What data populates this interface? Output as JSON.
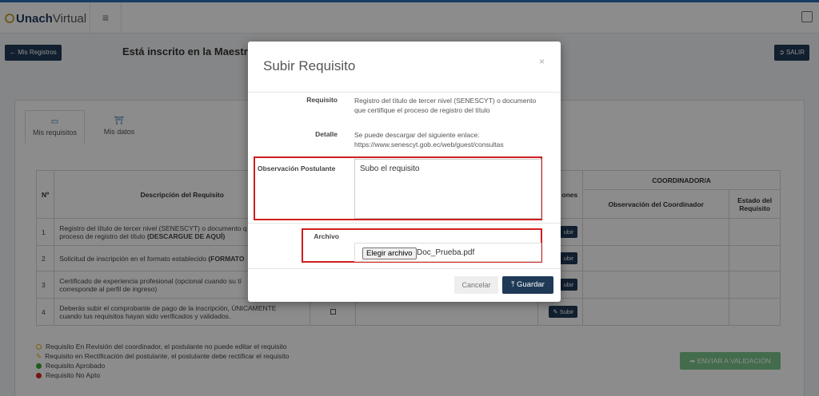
{
  "header": {
    "brand_bold": "Unach",
    "brand_light": "Virtual"
  },
  "toolbar": {
    "mis_registros": "Mis Registros",
    "salir": "SALIR"
  },
  "page": {
    "inscrito_text": "Está inscrito en la Maestría"
  },
  "tabs": [
    {
      "label": "Mis requisitos",
      "icon": "monitor-icon"
    },
    {
      "label": "Mis datos",
      "icon": "institution-icon"
    }
  ],
  "table": {
    "headers": {
      "num": "Nº",
      "descripcion": "Descripción del Requisito",
      "acciones": "ones",
      "coordinador": "COORDINADOR/A",
      "observacion": "Observación del Coordinador",
      "estado": "Estado del Requisito"
    },
    "rows": [
      {
        "num": "1",
        "desc": "Registro del título de tercer nivel (SENESCYT) o documento q",
        "desc2": "proceso de registro del título ",
        "desc2_bold": "(DESCARGUE DE AQUÍ)",
        "action": "ubir"
      },
      {
        "num": "2",
        "desc": "Solicitud de inscripción en el formato establecido ",
        "desc_bold": "(FORMATO",
        "action": "ubir"
      },
      {
        "num": "3",
        "desc": "Certificado de experiencia profesional (opcional cuando su tí",
        "desc2": "corresponde al perfil de ingreso)",
        "action": "ubir"
      },
      {
        "num": "4",
        "desc": "Deberás subir el comprobante de pago de la inscripción, ÚNICAMENTE",
        "desc2": "cuando tus requisitos hayan sido verificados y validados.",
        "action": "Subir"
      }
    ]
  },
  "legend": [
    {
      "text": "Requisito En Revisión del coordinador, el postulante no puede editar el requisito",
      "color": "#e6b400"
    },
    {
      "text": "Requisito en Rectificación del postulante, el postulante debe rectificar el requisito",
      "color": "#e6a800"
    },
    {
      "text": "Requisito Aprobado",
      "color": "#3aaa35"
    },
    {
      "text": "Requisito No Apto",
      "color": "#d9261c"
    }
  ],
  "enviar_validacion": "ENVIAR A VALIDACIÓN",
  "modal": {
    "title": "Subir Requisito",
    "close": "×",
    "requisito_label": "Requisito",
    "requisito_value_1": "Registro del título de tercer nivel (SENESCYT) o documento",
    "requisito_value_2": "que certifique el proceso de registro del título",
    "detalle_label": "Detalle",
    "detalle_value_1": "Se puede descargar del siguiente enlace:",
    "detalle_value_2": "https://www.senescyt.gob.ec/web/guest/consultas",
    "observacion_label": "Observación Postulante",
    "observacion_value": "Subo el requisito",
    "archivo_label": "Archivo",
    "file_button": "Elegir archivo",
    "file_name": "Doc_Prueba.pdf",
    "cancel": "Cancelar",
    "save": "Guardar"
  }
}
